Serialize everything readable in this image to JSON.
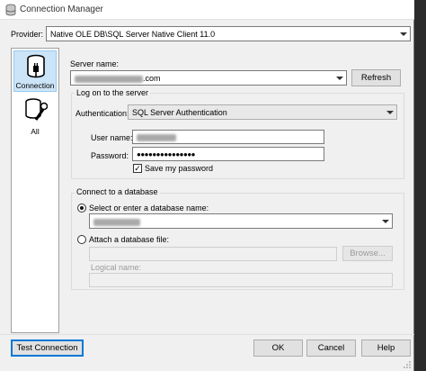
{
  "window": {
    "title": "Connection Manager"
  },
  "provider": {
    "label": "Provider:",
    "value": "Native OLE DB\\SQL Server Native Client 11.0"
  },
  "sidebar": {
    "items": [
      {
        "label": "Connection",
        "icon": "connection-icon",
        "selected": true
      },
      {
        "label": "All",
        "icon": "all-properties-icon",
        "selected": false
      }
    ]
  },
  "server": {
    "label": "Server name:",
    "value_suffix": ".com",
    "refresh_label": "Refresh"
  },
  "logon": {
    "group_title": "Log on to the server",
    "auth_label": "Authentication:",
    "auth_value": "SQL Server Authentication",
    "username_label": "User name:",
    "password_label": "Password:",
    "password_value": "●●●●●●●●●●●●●●●",
    "save_password_label": "Save my password",
    "save_password_checked": true
  },
  "database": {
    "group_title": "Connect to a database",
    "select_label": "Select or enter a database name:",
    "attach_label": "Attach a database file:",
    "browse_label": "Browse...",
    "logical_name_label": "Logical name:"
  },
  "footer": {
    "test_label": "Test Connection",
    "ok_label": "OK",
    "cancel_label": "Cancel",
    "help_label": "Help"
  }
}
